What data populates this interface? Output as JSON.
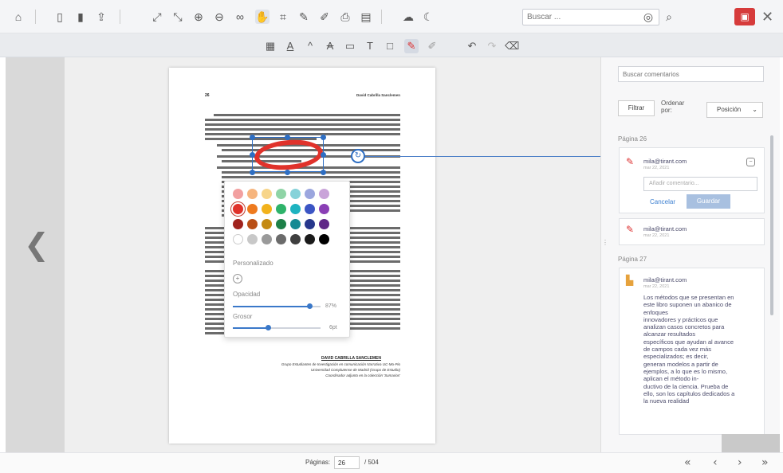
{
  "toolbar": {
    "icons": [
      "home-icon",
      "thumbnails-icon",
      "bookmark-icon",
      "share-icon",
      "fit-page-icon",
      "fit-width-icon",
      "zoom-in-icon",
      "zoom-out-icon",
      "link-icon",
      "pan-hand-icon",
      "select-area-icon",
      "edit-icon",
      "highlight-tool-icon",
      "print-icon",
      "document-icon",
      "cloud-icon",
      "night-mode-icon"
    ],
    "search_placeholder": "Buscar ...",
    "search_icon": "magnifier-icon"
  },
  "annotation_toolbar": {
    "tools": [
      "area-highlight-icon",
      "text-underline-icon",
      "text-caret-icon",
      "text-strike-icon",
      "sticky-note-icon",
      "text-box-icon",
      "rectangle-icon",
      "ink-pen-icon",
      "eraser-pen-icon",
      "undo-icon",
      "redo-icon",
      "clear-icon"
    ],
    "active_tool": "ink-pen-icon"
  },
  "document": {
    "page_number": "26",
    "running_head": "David Cabrilla Sanclemen",
    "author_name": "DAVID CABRILLA SANCLEMEN",
    "affiliation_lines": [
      "Grupo Estudiantes de Investigación en comunicación Narrativa UC-Mo-Pio",
      "Universidad Complutense de Madrid (Grupo de Estudio)",
      "Coordinador adjunto en la colección 'Sumarios'"
    ]
  },
  "color_picker": {
    "colors": [
      [
        "#f2a0a0",
        "#f6b57e",
        "#f7d58a",
        "#8fd4a6",
        "#86d2d9",
        "#9ba6de",
        "#c9a3d9"
      ],
      [
        "#e0322b",
        "#ee7a1e",
        "#f2b21c",
        "#2eb36a",
        "#1eb3c0",
        "#3b55c4",
        "#8a3fb5"
      ],
      [
        "#a0221d",
        "#b94f16",
        "#c48a12",
        "#1d8048",
        "#168a93",
        "#27378c",
        "#5f2787"
      ],
      [
        "#ffffff",
        "#c8c8c8",
        "#9a9a9a",
        "#6b6b6b",
        "#3f3f3f",
        "#1a1a1a",
        "#000000"
      ]
    ],
    "selected_color": "#e0322b",
    "custom_label": "Personalizado",
    "opacity_label": "Opacidad",
    "opacity_value": "87%",
    "opacity_fraction": 0.87,
    "thickness_label": "Grosor",
    "thickness_value": "6pt",
    "thickness_fraction": 0.4
  },
  "comments_panel": {
    "search_placeholder": "Buscar comentarios",
    "filter_button": "Filtrar",
    "order_label": "Ordenar por:",
    "order_value": "Posición",
    "page_26_label": "Página 26",
    "page_27_label": "Página 27",
    "comments": [
      {
        "user": "mila@tirant.com",
        "date": "mar 22, 2021",
        "input_placeholder": "Añadir comentario...",
        "cancel": "Cancelar",
        "save": "Guardar"
      },
      {
        "user": "mila@tirant.com",
        "date": "mar 22, 2021"
      },
      {
        "user": "mila@tirant.com",
        "date": "mar 22, 2021",
        "text": "Los métodos que se presentan en\neste libro suponen un abanico de\nenfoques\ninnovadores y prácticos que\nanalizan casos concretos para\nalcanzar resultados\nespecíficos que ayudan al avance\nde campos cada vez más\nespecializados; es decir,\ngeneran modelos a partir de\nejemplos, a lo que es lo mismo,\naplican el método in-\nductivo de la ciencia. Prueba de\nello, son los capítulos dedicados a\nla nueva realidad"
      }
    ]
  },
  "footer": {
    "pages_label": "Páginas:",
    "current_page": "26",
    "total_pages": "/ 504"
  }
}
